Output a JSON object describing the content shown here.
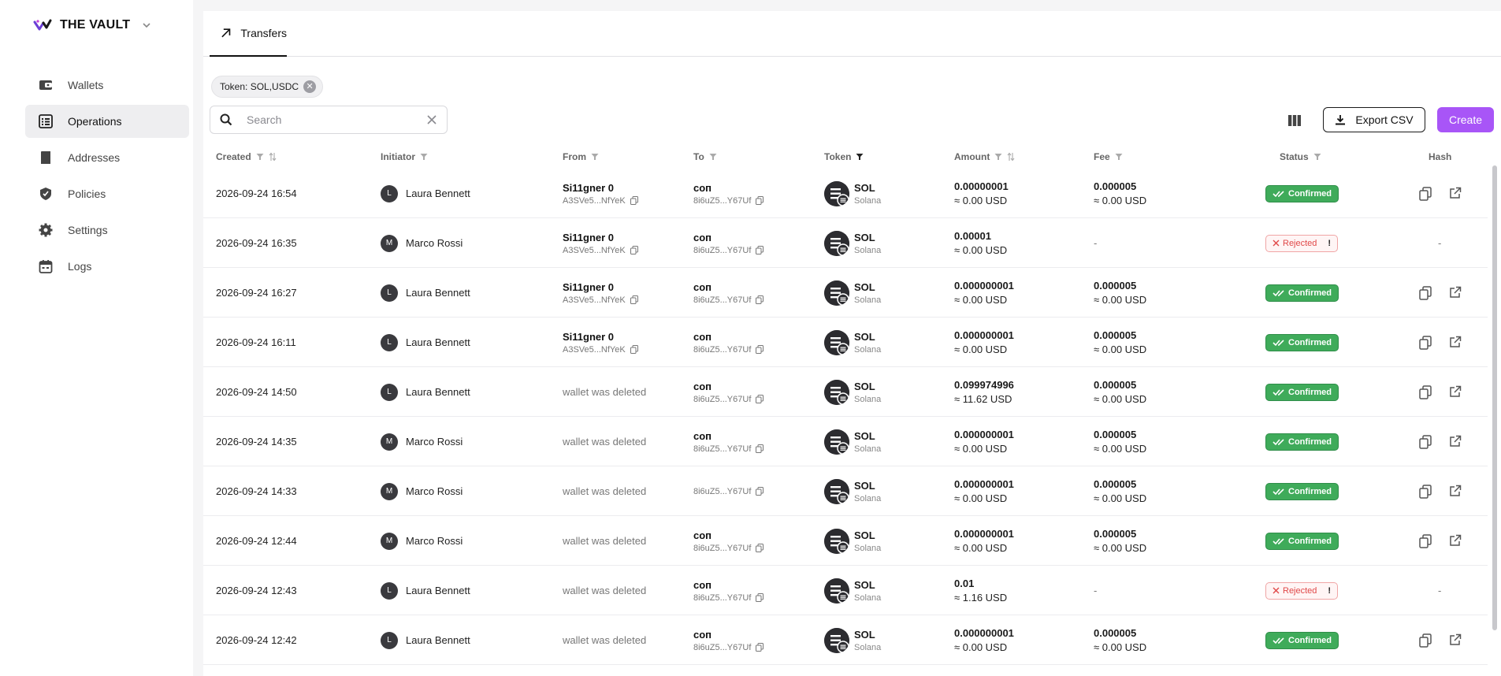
{
  "brand": {
    "name": "THE VAULT"
  },
  "sidebar": {
    "items": [
      {
        "label": "Wallets",
        "icon": "wallet-icon"
      },
      {
        "label": "Operations",
        "icon": "list-icon",
        "active": true
      },
      {
        "label": "Addresses",
        "icon": "book-icon"
      },
      {
        "label": "Policies",
        "icon": "shield-icon"
      },
      {
        "label": "Settings",
        "icon": "gear-icon"
      },
      {
        "label": "Logs",
        "icon": "calendar-icon"
      }
    ]
  },
  "tabs": [
    {
      "label": "Transfers",
      "icon": "arrow-up-right-icon"
    }
  ],
  "filter_chip": {
    "label": "Token: SOL,USDC"
  },
  "search": {
    "placeholder": "Search",
    "value": ""
  },
  "toolbar": {
    "export_label": "Export CSV",
    "create_label": "Create"
  },
  "colors": {
    "accent": "#a855f7",
    "confirmed": "#3fab5a",
    "rejected": "#e04848"
  },
  "table": {
    "columns": [
      "Created",
      "Initiator",
      "From",
      "To",
      "Token",
      "Amount",
      "Fee",
      "Status",
      "Hash"
    ],
    "rows": [
      {
        "created": "2026-09-24 16:54",
        "avatar": "L",
        "initiator": "Laura Bennett",
        "from_name": "Si11gner 0",
        "from_addr": "A3SVe5...NfYeK",
        "from_deleted": "",
        "to_name": "соп",
        "to_addr": "8i6uZ5...Y67Uf",
        "token": "SOL",
        "network": "Solana",
        "amount": "0.00000001",
        "amount_usd": "≈ 0.00 USD",
        "fee": "0.000005",
        "fee_usd": "≈ 0.00 USD",
        "status": "Confirmed",
        "hash": true
      },
      {
        "created": "2026-09-24 16:35",
        "avatar": "M",
        "initiator": "Marco Rossi",
        "from_name": "Si11gner 0",
        "from_addr": "A3SVe5...NfYeK",
        "from_deleted": "",
        "to_name": "соп",
        "to_addr": "8i6uZ5...Y67Uf",
        "token": "SOL",
        "network": "Solana",
        "amount": "0.00001",
        "amount_usd": "≈ 0.00 USD",
        "fee": "-",
        "fee_usd": "",
        "status": "Rejected",
        "hash": false
      },
      {
        "created": "2026-09-24 16:27",
        "avatar": "L",
        "initiator": "Laura Bennett",
        "from_name": "Si11gner 0",
        "from_addr": "A3SVe5...NfYeK",
        "from_deleted": "",
        "to_name": "соп",
        "to_addr": "8i6uZ5...Y67Uf",
        "token": "SOL",
        "network": "Solana",
        "amount": "0.000000001",
        "amount_usd": "≈ 0.00 USD",
        "fee": "0.000005",
        "fee_usd": "≈ 0.00 USD",
        "status": "Confirmed",
        "hash": true
      },
      {
        "created": "2026-09-24 16:11",
        "avatar": "L",
        "initiator": "Laura Bennett",
        "from_name": "Si11gner 0",
        "from_addr": "A3SVe5...NfYeK",
        "from_deleted": "",
        "to_name": "соп",
        "to_addr": "8i6uZ5...Y67Uf",
        "token": "SOL",
        "network": "Solana",
        "amount": "0.000000001",
        "amount_usd": "≈ 0.00 USD",
        "fee": "0.000005",
        "fee_usd": "≈ 0.00 USD",
        "status": "Confirmed",
        "hash": true
      },
      {
        "created": "2026-09-24 14:50",
        "avatar": "L",
        "initiator": "Laura Bennett",
        "from_name": "",
        "from_addr": "",
        "from_deleted": "wallet was deleted",
        "to_name": "соп",
        "to_addr": "8i6uZ5...Y67Uf",
        "token": "SOL",
        "network": "Solana",
        "amount": "0.099974996",
        "amount_usd": "≈ 11.62 USD",
        "fee": "0.000005",
        "fee_usd": "≈ 0.00 USD",
        "status": "Confirmed",
        "hash": true
      },
      {
        "created": "2026-09-24 14:35",
        "avatar": "M",
        "initiator": "Marco Rossi",
        "from_name": "",
        "from_addr": "",
        "from_deleted": "wallet was deleted",
        "to_name": "соп",
        "to_addr": "8i6uZ5...Y67Uf",
        "token": "SOL",
        "network": "Solana",
        "amount": "0.000000001",
        "amount_usd": "≈ 0.00 USD",
        "fee": "0.000005",
        "fee_usd": "≈ 0.00 USD",
        "status": "Confirmed",
        "hash": true
      },
      {
        "created": "2026-09-24 14:33",
        "avatar": "M",
        "initiator": "Marco Rossi",
        "from_name": "",
        "from_addr": "",
        "from_deleted": "wallet was deleted",
        "to_name": "",
        "to_addr": "8i6uZ5...Y67Uf",
        "token": "SOL",
        "network": "Solana",
        "amount": "0.000000001",
        "amount_usd": "≈ 0.00 USD",
        "fee": "0.000005",
        "fee_usd": "≈ 0.00 USD",
        "status": "Confirmed",
        "hash": true
      },
      {
        "created": "2026-09-24 12:44",
        "avatar": "M",
        "initiator": "Marco Rossi",
        "from_name": "",
        "from_addr": "",
        "from_deleted": "wallet was deleted",
        "to_name": "соп",
        "to_addr": "8i6uZ5...Y67Uf",
        "token": "SOL",
        "network": "Solana",
        "amount": "0.000000001",
        "amount_usd": "≈ 0.00 USD",
        "fee": "0.000005",
        "fee_usd": "≈ 0.00 USD",
        "status": "Confirmed",
        "hash": true
      },
      {
        "created": "2026-09-24 12:43",
        "avatar": "L",
        "initiator": "Laura Bennett",
        "from_name": "",
        "from_addr": "",
        "from_deleted": "wallet was deleted",
        "to_name": "соп",
        "to_addr": "8i6uZ5...Y67Uf",
        "token": "SOL",
        "network": "Solana",
        "amount": "0.01",
        "amount_usd": "≈ 1.16 USD",
        "fee": "-",
        "fee_usd": "",
        "status": "Rejected",
        "hash": false
      },
      {
        "created": "2026-09-24 12:42",
        "avatar": "L",
        "initiator": "Laura Bennett",
        "from_name": "",
        "from_addr": "",
        "from_deleted": "wallet was deleted",
        "to_name": "соп",
        "to_addr": "8i6uZ5...Y67Uf",
        "token": "SOL",
        "network": "Solana",
        "amount": "0.000000001",
        "amount_usd": "≈ 0.00 USD",
        "fee": "0.000005",
        "fee_usd": "≈ 0.00 USD",
        "status": "Confirmed",
        "hash": true
      }
    ]
  }
}
